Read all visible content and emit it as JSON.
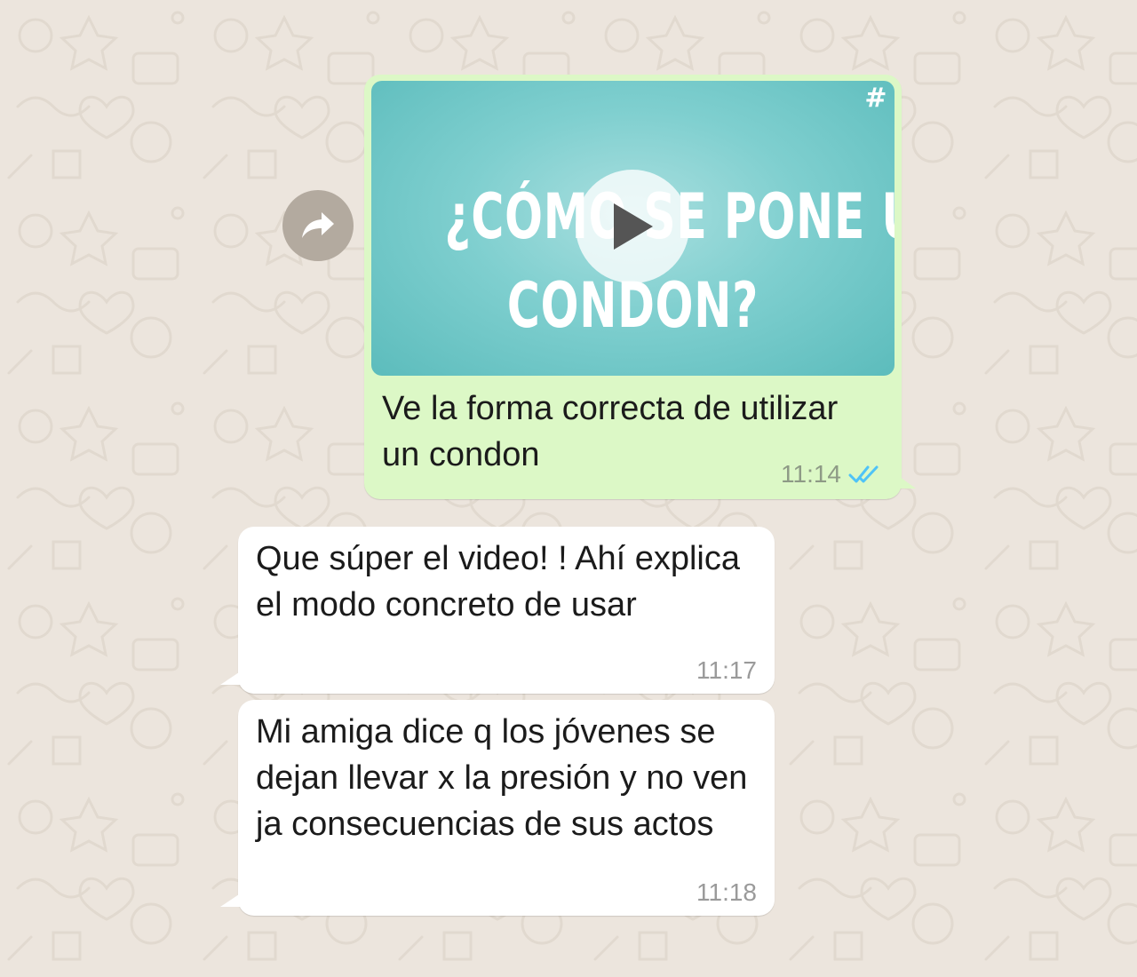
{
  "video_message": {
    "thumbnail_line1": "¿CÓMO SE PONE UN",
    "thumbnail_line2": "CONDON?",
    "thumbnail_logo": "#",
    "caption": "Ve la forma correcta de utilizar un condon",
    "time": "11:14",
    "status_icon": "double-check-read-icon",
    "status_color": "#4fc3f7",
    "forward_icon": "forward-arrow-icon",
    "play_icon": "play-icon"
  },
  "incoming_messages": [
    {
      "text": "Que súper el video! ! Ahí explica el modo concreto de usar",
      "time": "11:17"
    },
    {
      "text": "Mi amiga dice q los jóvenes se dejan llevar x la presión y no ven ja consecuencias de sus actos",
      "time": "11:18"
    }
  ],
  "colors": {
    "background": "#ece5dd",
    "outgoing_bubble": "#dcf8c6",
    "incoming_bubble": "#ffffff",
    "video_thumbnail": "#7fcfcf"
  }
}
